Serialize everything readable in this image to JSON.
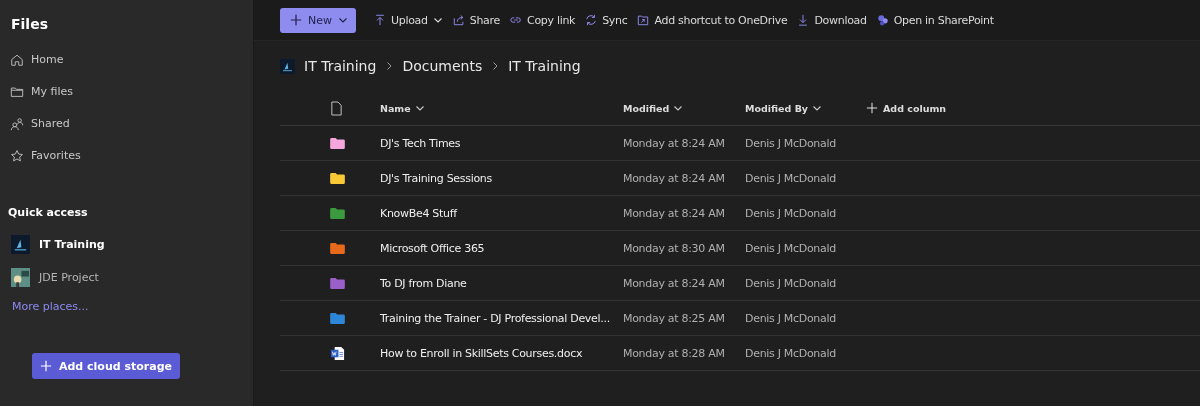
{
  "sidebar": {
    "title": "Files",
    "nav": [
      {
        "label": "Home",
        "kind": "home"
      },
      {
        "label": "My files",
        "kind": "folder"
      },
      {
        "label": "Shared",
        "kind": "people"
      },
      {
        "label": "Favorites",
        "kind": "star"
      }
    ],
    "quick_access_heading": "Quick access",
    "quick_access": [
      {
        "label": "IT Training",
        "selected": true,
        "kind": "dark"
      },
      {
        "label": "JDE Project",
        "selected": false,
        "kind": "bulb"
      }
    ],
    "more_link": "More places...",
    "add_button": "Add cloud storage"
  },
  "toolbar": {
    "new_button": "New",
    "actions": [
      {
        "label": "Upload",
        "kind": "upload",
        "dropdown": true
      },
      {
        "label": "Share",
        "kind": "share",
        "dropdown": false
      },
      {
        "label": "Copy link",
        "kind": "link",
        "dropdown": false
      },
      {
        "label": "Sync",
        "kind": "sync",
        "dropdown": false
      },
      {
        "label": "Add shortcut to OneDrive",
        "kind": "shortcut",
        "dropdown": false
      },
      {
        "label": "Download",
        "kind": "download",
        "dropdown": false
      },
      {
        "label": "Open in SharePoint",
        "kind": "sharepoint",
        "dropdown": false
      }
    ]
  },
  "breadcrumb": [
    "IT Training",
    "Documents",
    "IT Training"
  ],
  "table": {
    "columns": [
      "Name",
      "Modified",
      "Modified By"
    ],
    "add_column": "Add column",
    "rows": [
      {
        "kind": "folder",
        "color": "#f4a6dd",
        "name": "DJ's Tech Times",
        "modified": "Monday at 8:24 AM",
        "modified_by": "Denis J McDonald"
      },
      {
        "kind": "folder",
        "color": "#f8c935",
        "name": "DJ's Training Sessions",
        "modified": "Monday at 8:24 AM",
        "modified_by": "Denis J McDonald"
      },
      {
        "kind": "folder",
        "color": "#3a9a3d",
        "name": "KnowBe4 Stuff",
        "modified": "Monday at 8:24 AM",
        "modified_by": "Denis J McDonald"
      },
      {
        "kind": "folder",
        "color": "#e8691a",
        "name": "Microsoft Office 365",
        "modified": "Monday at 8:30 AM",
        "modified_by": "Denis J McDonald"
      },
      {
        "kind": "folder",
        "color": "#9a5fc8",
        "name": "To DJ from Diane",
        "modified": "Monday at 8:24 AM",
        "modified_by": "Denis J McDonald"
      },
      {
        "kind": "folder",
        "color": "#2e86d8",
        "name": "Training the Trainer - DJ Professional Devel...",
        "modified": "Monday at 8:25 AM",
        "modified_by": "Denis J McDonald"
      },
      {
        "kind": "word",
        "name": "How to Enroll in SkillSets Courses.docx",
        "modified": "Monday at 8:28 AM",
        "modified_by": "Denis J McDonald"
      }
    ]
  }
}
